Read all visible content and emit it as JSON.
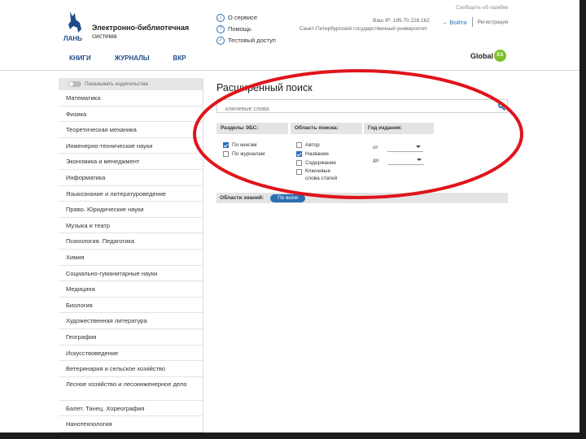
{
  "header": {
    "brand_word": "ЛАНЬ",
    "brand_name": "Электронно-библиотечная",
    "brand_sub": "система",
    "report_link": "Сообщить об ошибке",
    "ip_text": "Ваш IP: 195.70.228.162",
    "university": "Санкт-Петербургский государственный университет",
    "login": "Войти",
    "register": "Регистрация",
    "top_links": [
      {
        "label": "О сервисе",
        "icon": "info-icon"
      },
      {
        "label": "Помощь",
        "icon": "help-icon"
      },
      {
        "label": "Тестовый доступ",
        "icon": "check-icon"
      }
    ],
    "nav": [
      "КНИГИ",
      "ЖУРНАЛЫ",
      "ВКР"
    ],
    "global_text": "Global",
    "global_badge": "ES"
  },
  "sidebar": {
    "toggle_label": "Показывать издательства",
    "items": [
      "Математика",
      "Физика",
      "Теоретическая механика",
      "Инженерно-технические науки",
      "Экономика и менеджмент",
      "Информатика",
      "Языкознание и литературоведение",
      "Право. Юридические науки",
      "Музыка и театр",
      "Психология. Педагогика",
      "Химия",
      "Социально-гуманитарные науки",
      "Медицина",
      "Биология",
      "Художественная литература",
      "География",
      "Искусствоведение",
      "Ветеринария и сельское хозяйство",
      "Лесное хозяйство и лесоинженерное дело",
      "Балет. Танец. Хореография",
      "Нанотехнология"
    ]
  },
  "main": {
    "title": "Расширенный поиск",
    "search_placeholder": "ключевые слова",
    "sections": {
      "ebs": {
        "title": "Разделы ЭБС:",
        "options": [
          {
            "label": "По книгам",
            "checked": true
          },
          {
            "label": "По журналам",
            "checked": false
          }
        ]
      },
      "scope": {
        "title": "Область поиска:",
        "options": [
          {
            "label": "Автор",
            "checked": false
          },
          {
            "label": "Название",
            "checked": true
          },
          {
            "label": "Содержание",
            "checked": false
          },
          {
            "label": "Ключевые слова статей",
            "checked": false
          }
        ]
      },
      "year": {
        "title": "Год издания:",
        "from": "от",
        "to": "до"
      }
    },
    "areas_label": "Области знаний:",
    "areas_pill": "По всем"
  },
  "colors": {
    "accent": "#2b6fb4",
    "highlight_oval": "#e0141c",
    "global_badge": "#7cbf2a"
  }
}
